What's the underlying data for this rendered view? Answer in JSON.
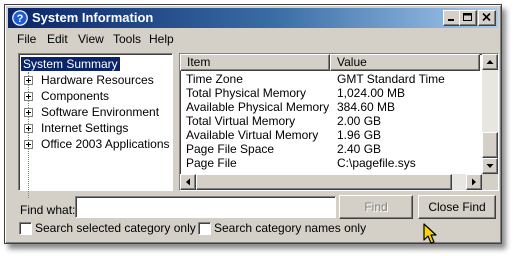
{
  "window": {
    "title": "System Information",
    "title_icon": "help-question-icon",
    "controls": [
      "minimize-icon",
      "maximize-icon",
      "close-icon"
    ]
  },
  "menu": {
    "items": [
      "File",
      "Edit",
      "View",
      "Tools",
      "Help"
    ]
  },
  "tree": {
    "root": "System Summary",
    "children": [
      "Hardware Resources",
      "Components",
      "Software Environment",
      "Internet Settings",
      "Office 2003 Applications"
    ]
  },
  "list": {
    "columns": [
      "Item",
      "Value"
    ],
    "rows": [
      {
        "item": "Time Zone",
        "value": "GMT Standard Time"
      },
      {
        "item": "Total Physical Memory",
        "value": "1,024.00 MB"
      },
      {
        "item": "Available Physical Memory",
        "value": "384.60 MB"
      },
      {
        "item": "Total Virtual Memory",
        "value": "2.00 GB"
      },
      {
        "item": "Available Virtual Memory",
        "value": "1.96 GB"
      },
      {
        "item": "Page File Space",
        "value": "2.40 GB"
      },
      {
        "item": "Page File",
        "value": "C:\\pagefile.sys"
      }
    ],
    "vertical_scroll_position": 0.9
  },
  "find": {
    "label": "Find what:",
    "value": "",
    "find_button": "Find",
    "close_find_button": "Close Find",
    "option_selected_category": "Search selected category only",
    "option_category_names": "Search category names only"
  },
  "colors": {
    "title_gradient_start": "#0a246a",
    "title_gradient_end": "#a6caf0",
    "face": "#d4d0c8",
    "selection": "#0a246a",
    "cursor": "#ffd400"
  }
}
